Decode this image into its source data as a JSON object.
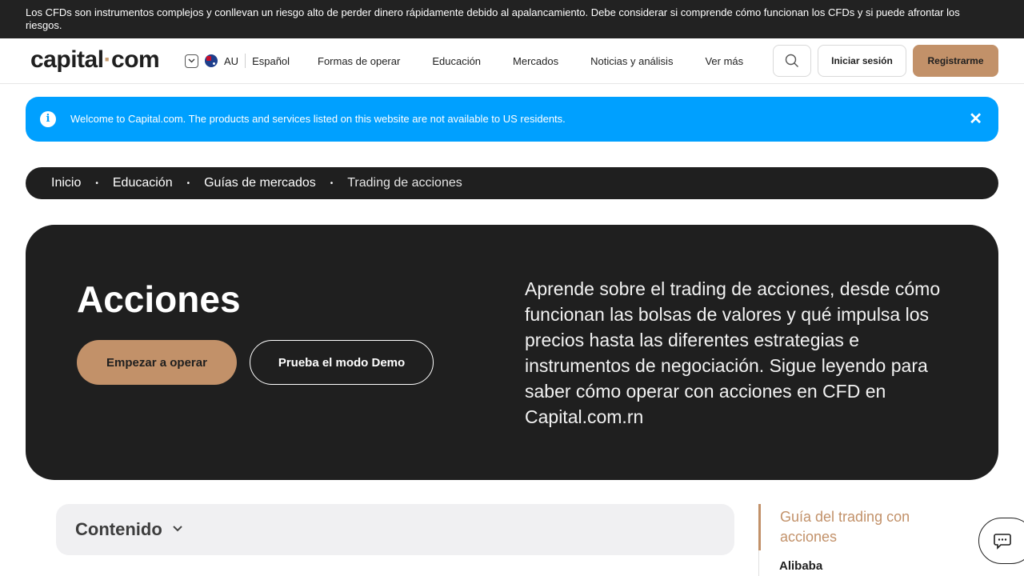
{
  "risk_banner": {
    "text": "Los CFDs son instrumentos complejos y conllevan un riesgo alto de perder dinero rápidamente debido al apalancamiento. Debe considerar si comprende cómo funcionan los CFDs y si puede afrontar los riesgos."
  },
  "header": {
    "logo_left": "capital",
    "logo_dot": "·",
    "logo_right": "com",
    "region_code": "AU",
    "language": "Español",
    "nav": [
      "Formas de operar",
      "Educación",
      "Mercados",
      "Noticias y análisis",
      "Ver más"
    ],
    "login_label": "Iniciar sesión",
    "signup_label": "Registrarme"
  },
  "notice": {
    "text": "Welcome to Capital.com. The products and services listed on this website are not available to US residents.",
    "info_glyph": "i",
    "close_glyph": "✕"
  },
  "breadcrumb": {
    "items": [
      "Inicio",
      "Educación",
      "Guías de mercados",
      "Trading de acciones"
    ],
    "separator": "•"
  },
  "hero": {
    "title": "Acciones",
    "primary_button": "Empezar a operar",
    "secondary_button": "Prueba el modo Demo",
    "description": "Aprende sobre el trading de acciones, desde cómo funcionan las bolsas de valores y qué impulsa los precios hasta las diferentes estrategias e instrumentos de negociación. Sigue leyendo para saber cómo operar con acciones en CFD en Capital.com.rn"
  },
  "contents": {
    "label": "Contenido"
  },
  "side_guide": {
    "active_item": "Guía del trading con acciones",
    "items": [
      "Alibaba"
    ]
  },
  "colors": {
    "accent": "#c29169",
    "notice_blue": "#00a0ff",
    "dark": "#1f1f1f"
  }
}
